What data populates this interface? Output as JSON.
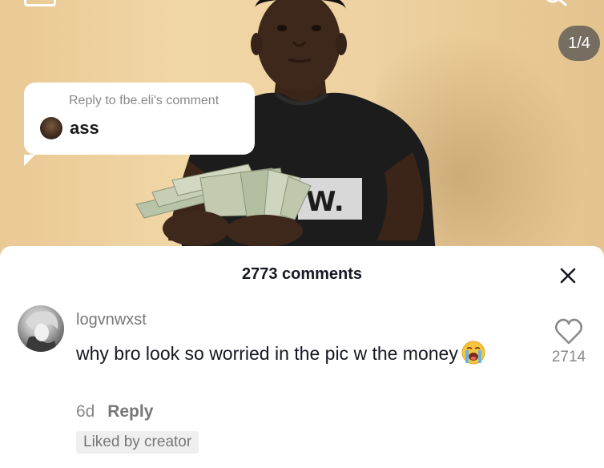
{
  "video": {
    "page_indicator": "1/4",
    "shirt_logo_text": "W."
  },
  "reply_bubble": {
    "reply_to": "Reply to fbe.eli's comment",
    "text": "ass"
  },
  "comments_panel": {
    "count_label": "2773 comments",
    "comment": {
      "username": "logvnwxst",
      "text": "why bro look so worried in the pic w the money",
      "emoji": "loudly-crying-face",
      "age": "6d",
      "reply_label": "Reply",
      "liked_badge": "Liked by creator",
      "like_count": "2714"
    }
  },
  "colors": {
    "wall": "#eed2a2",
    "shirt": "#1c1c1c",
    "panel_text": "#161823",
    "muted_text": "#888888"
  }
}
